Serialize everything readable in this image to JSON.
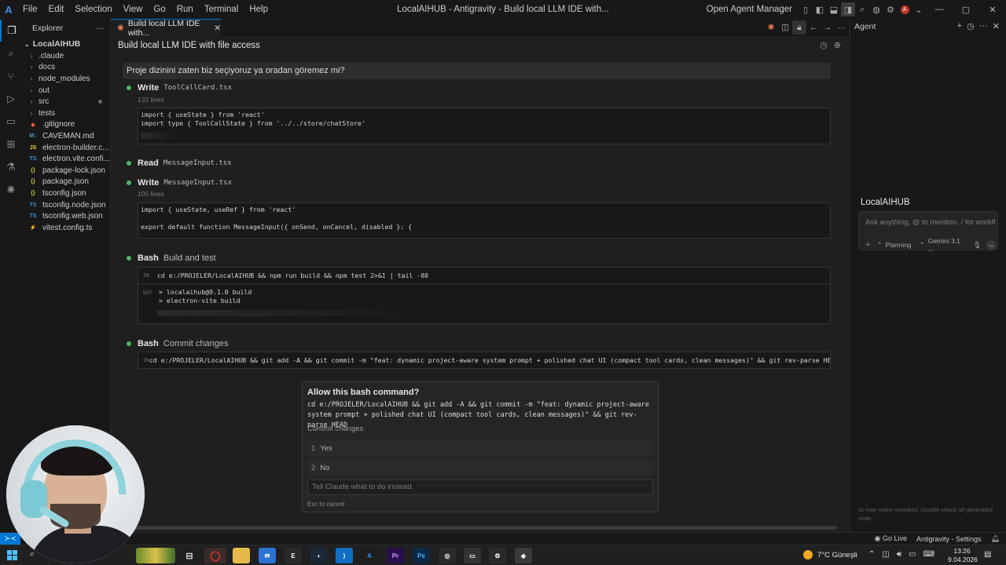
{
  "window": {
    "title": "LocalAIHUB - Antigravity - Build local LLM IDE with...",
    "menu": [
      "File",
      "Edit",
      "Selection",
      "View",
      "Go",
      "Run",
      "Terminal",
      "Help"
    ],
    "open_agent_manager": "Open Agent Manager",
    "avatar_letter": "A"
  },
  "explorer": {
    "header": "Explorer",
    "root": "LocalAIHUB",
    "items": [
      {
        "label": ".claude",
        "type": "folder"
      },
      {
        "label": "docs",
        "type": "folder"
      },
      {
        "label": "node_modules",
        "type": "folder"
      },
      {
        "label": "out",
        "type": "folder"
      },
      {
        "label": "src",
        "type": "folder"
      },
      {
        "label": "tests",
        "type": "folder"
      },
      {
        "label": ".gitignore",
        "type": "gitignore"
      },
      {
        "label": "CAVEMAN.md",
        "type": "md"
      },
      {
        "label": "electron-builder.c...",
        "type": "js"
      },
      {
        "label": "electron.vite.confi...",
        "type": "ts"
      },
      {
        "label": "package-lock.json",
        "type": "json"
      },
      {
        "label": "package.json",
        "type": "json"
      },
      {
        "label": "tsconfig.json",
        "type": "json"
      },
      {
        "label": "tsconfig.node.json",
        "type": "ts"
      },
      {
        "label": "tsconfig.web.json",
        "type": "ts"
      },
      {
        "label": "vitest.config.ts",
        "type": "vitest"
      }
    ]
  },
  "editor": {
    "tab_label": "Build local LLM IDE with...",
    "conversation_title": "Build local LLM IDE with file access",
    "user_message": "Proje dizinini zaten biz seçiyoruz ya oradan göremez mi?",
    "steps": {
      "write1": {
        "tool": "Write",
        "file": "ToolCallCard.tsx",
        "sub": "132 lines",
        "code": [
          "import { useState } from 'react'",
          "import type { ToolCallState } from '../../store/chatStore'"
        ]
      },
      "read1": {
        "tool": "Read",
        "file": "MessageInput.tsx"
      },
      "write2": {
        "tool": "Write",
        "file": "MessageInput.tsx",
        "sub": "105 lines",
        "code": [
          "import { useState, useRef } from 'react'",
          "",
          "export default function MessageInput({ onSend, onCancel, disabled }: {"
        ]
      },
      "bash1": {
        "tool": "Bash",
        "desc": "Build and test",
        "in_tag": "IN",
        "out_tag": "OUT",
        "command": "cd e:/PROJELER/LocalAIHUB && npm run build && npm test 2>&1 | tail -80",
        "output": [
          "> localaihub@0.1.0 build",
          "> electron-vite build"
        ]
      },
      "bash2": {
        "tool": "Bash",
        "desc": "Commit changes",
        "in_tag": "IN",
        "command": "cd e:/PROJELER/LocalAIHUB && git add -A && git commit -m \"feat: dynamic project-aware system prompt + polished chat UI (compact tool cards, clean messages)\" && git rev-parse HEAD"
      }
    }
  },
  "permission": {
    "title": "Allow this bash command?",
    "command": "cd e:/PROJELER/LocalAIHUB && git add -A && git commit -m \"feat: dynamic project-aware system prompt + polished chat UI (compact tool cards, clean messages)\" && git rev-parse HEAD",
    "description": "Commit changes",
    "options": [
      {
        "num": "1",
        "label": "Yes"
      },
      {
        "num": "2",
        "label": "No"
      }
    ],
    "instead_placeholder": "Tell Claude what to do instead",
    "esc_hint": "Esc to cancel"
  },
  "agent": {
    "header": "Agent",
    "workspace_title": "LocalAIHUB",
    "input_placeholder": "Ask anything, @ to mention, / for workfl...",
    "mode": "Planning",
    "model": "Gemini 3.1 ...",
    "disclaimer": "AI may make mistakes. Double-check all generated code."
  },
  "statusbar": {
    "go_live": "Go Live",
    "settings": "Antigravity - Settings"
  },
  "taskbar": {
    "weather": "7°C  Güneşli",
    "time": "13:26",
    "date": "9.04.2026"
  }
}
